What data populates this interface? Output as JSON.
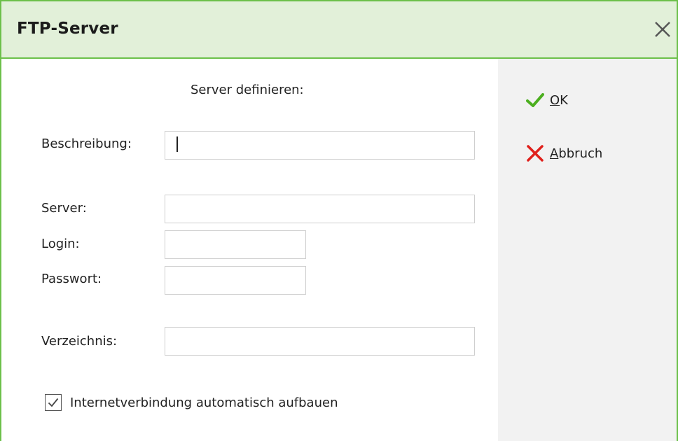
{
  "dialog": {
    "title": "FTP-Server",
    "close_icon": "close-icon"
  },
  "form": {
    "heading": "Server definieren:",
    "description_label": "Beschreibung:",
    "description_value": "",
    "server_label": "Server:",
    "server_value": "",
    "login_label": "Login:",
    "login_value": "",
    "password_label": "Passwort:",
    "password_value": "",
    "directory_label": "Verzeichnis:",
    "directory_value": "",
    "auto_connect_label": "Internetverbindung automatisch aufbauen",
    "auto_connect_checked": true
  },
  "actions": {
    "ok_mnemonic": "O",
    "ok_rest": "K",
    "ok_icon": "check-icon",
    "cancel_mnemonic": "A",
    "cancel_rest": "bbruch",
    "cancel_icon": "x-icon"
  },
  "colors": {
    "accent_green": "#6cc04a",
    "titlebar_bg": "#e2f0d9",
    "ok_green": "#4caf20",
    "cancel_red": "#e0201b",
    "side_panel_bg": "#f2f2f2"
  }
}
